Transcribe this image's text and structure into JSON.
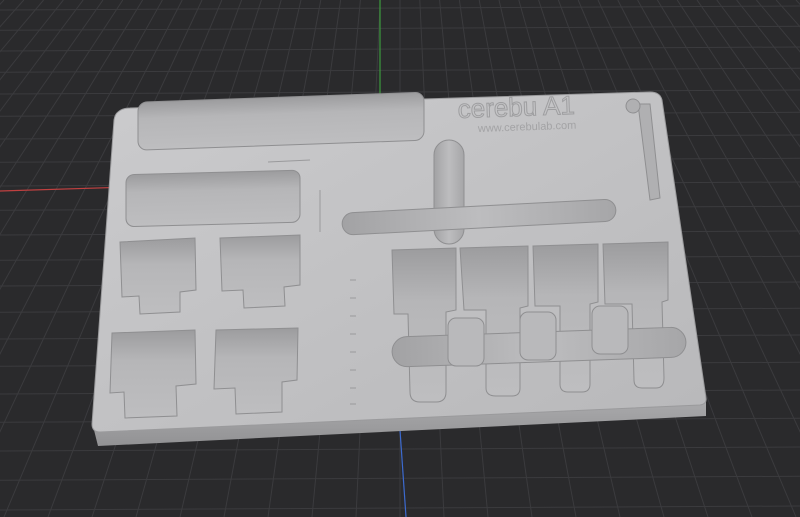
{
  "viewport": {
    "background": "#2a2a2c",
    "grid_color": "#3b3b3e",
    "axis_x_color": "#c04040",
    "axis_y_color": "#3c9a3c",
    "axis_z_color": "#3c6ad0"
  },
  "model": {
    "engraving_title": "cerebu A1",
    "engraving_url": "www.cerebulab.com",
    "base_color": "#a7a7a9",
    "top_color": "#c4c4c6",
    "pocket_color": "#b2b2b4",
    "side_color": "#989899",
    "icon": "tray-insert-model"
  }
}
